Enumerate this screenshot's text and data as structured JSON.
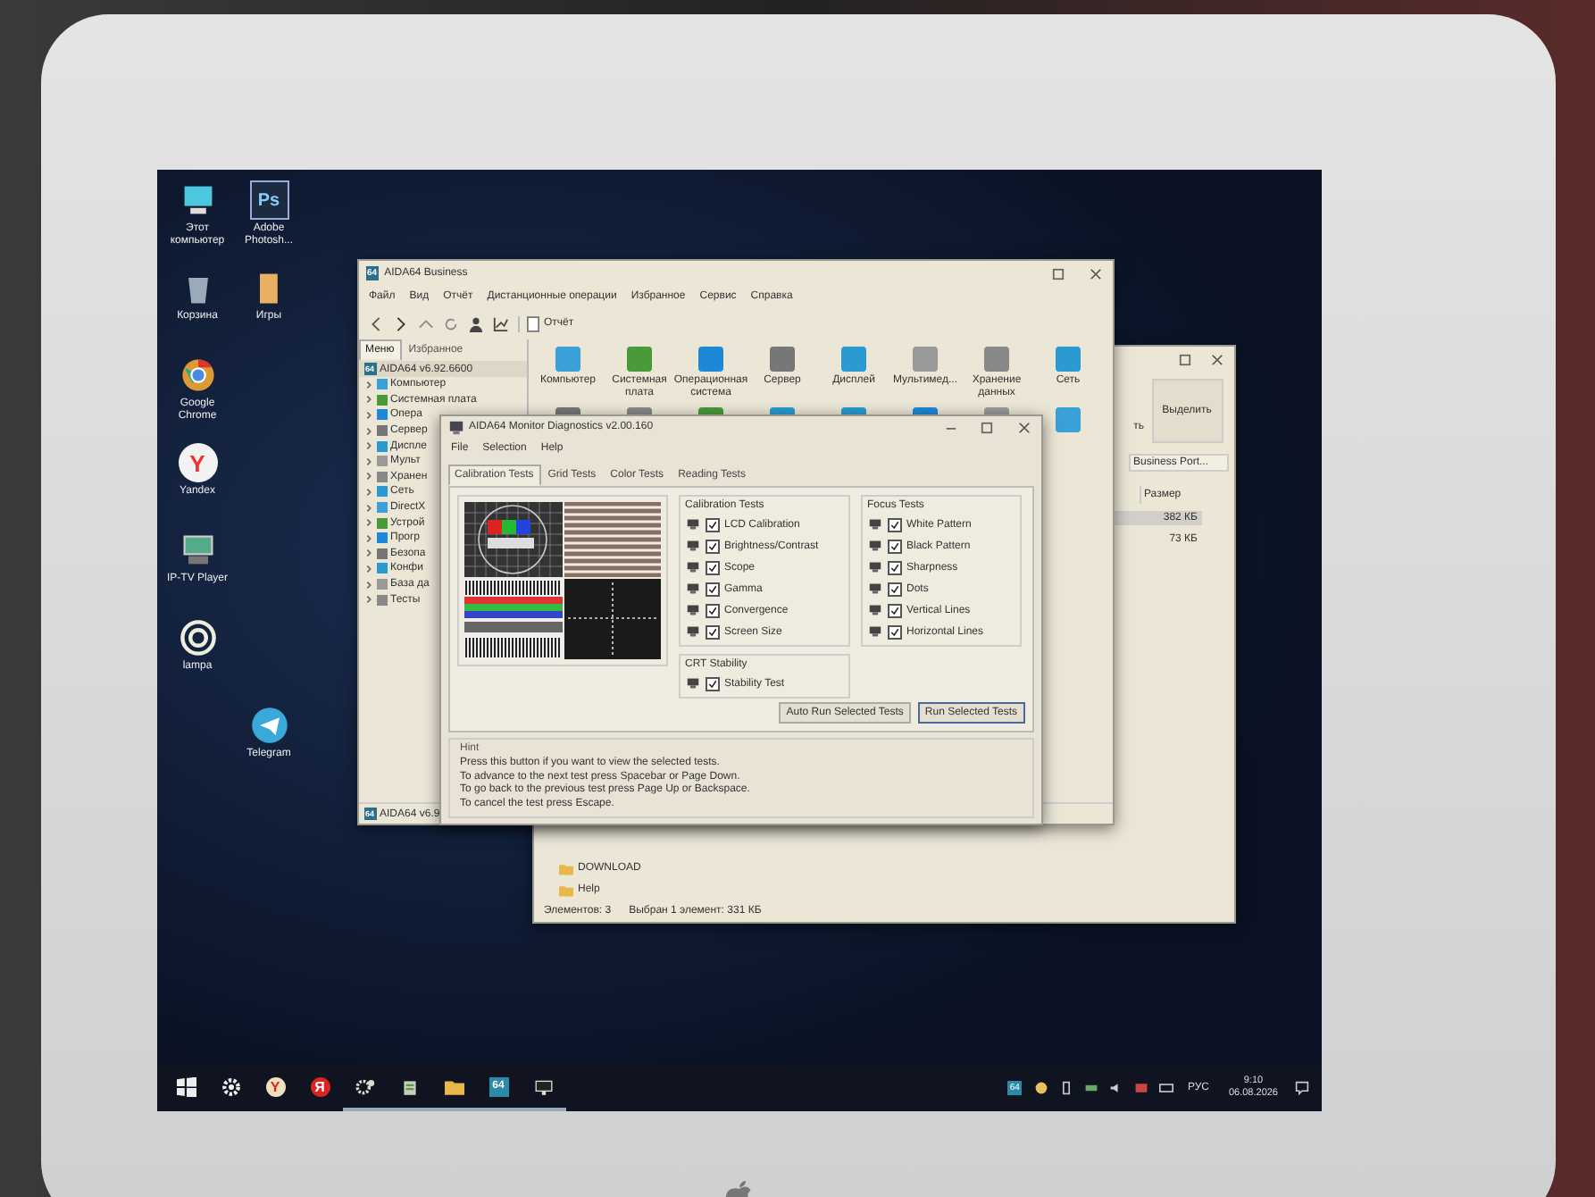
{
  "desktop_icons": [
    {
      "kind": "computer",
      "label": "Этот компьютер"
    },
    {
      "kind": "trash",
      "label": "Корзина"
    },
    {
      "kind": "chrome",
      "label": "Google Chrome"
    },
    {
      "kind": "yandex",
      "label": "Yandex",
      "icon_text": "Y"
    },
    {
      "kind": "tv",
      "label": "IP-TV Player"
    },
    {
      "kind": "lamp",
      "label": "lampa"
    },
    {
      "kind": "photoshop",
      "label": "Adobe Photosh...",
      "icon_text": "Ps"
    },
    {
      "kind": "folder",
      "label": "Игры"
    },
    {
      "kind": "telegram",
      "label": "Telegram"
    }
  ],
  "explorer_window": {
    "ribbon_button": "Выделить",
    "ribbon_fragment": "ть",
    "search": "Business Port...",
    "column": "Размер",
    "sizes": [
      "382 КБ",
      "73 КБ"
    ],
    "folders": [
      "DOWNLOAD",
      "Help"
    ],
    "status": [
      "Элементов: 3",
      "Выбран 1 элемент: 331 КБ"
    ]
  },
  "aida_window": {
    "title_icon_text": "64",
    "title": "AIDA64 Business",
    "menu": [
      "Файл",
      "Вид",
      "Отчёт",
      "Дистанционные операции",
      "Избранное",
      "Сервис",
      "Справка"
    ],
    "toolbar_button": "Отчёт",
    "tabs": [
      {
        "label": "Меню",
        "selected": true
      },
      {
        "label": "Избранное",
        "selected": false
      }
    ],
    "tree": {
      "icon_text": "64",
      "label": "AIDA64 v6.92.6600",
      "children": [
        {
          "label": "Компьютер",
          "expanded": false
        },
        {
          "label": "Системная плата",
          "expanded": false
        },
        {
          "label": "Опера",
          "expanded": false
        },
        {
          "label": "Сервер",
          "expanded": false
        },
        {
          "label": "Диспле",
          "expanded": false
        },
        {
          "label": "Мульт",
          "expanded": false
        },
        {
          "label": "Хранен",
          "expanded": false
        },
        {
          "label": "Сеть",
          "expanded": false
        },
        {
          "label": "DirectX",
          "expanded": false
        },
        {
          "label": "Устрой",
          "expanded": false
        },
        {
          "label": "Прогр",
          "expanded": false
        },
        {
          "label": "Безопа",
          "expanded": false
        },
        {
          "label": "Конфи",
          "expanded": false
        },
        {
          "label": "База да",
          "expanded": false
        },
        {
          "label": "Тесты",
          "expanded": false
        }
      ]
    },
    "categories": [
      "Компьютер",
      "Системная плата",
      "Операционная система",
      "Сервер",
      "Дисплей",
      "Мультимед...",
      "Хранение данных",
      "Сеть"
    ],
    "status_icon_text": "64",
    "status": "AIDA64 v6.9"
  },
  "diagnostics_dialog": {
    "title": "AIDA64 Monitor Diagnostics v2.00.160",
    "menu": [
      "File",
      "Selection",
      "Help"
    ],
    "tabs": [
      {
        "label": "Calibration Tests",
        "selected": true
      },
      {
        "label": "Grid Tests",
        "selected": false
      },
      {
        "label": "Color Tests",
        "selected": false
      },
      {
        "label": "Reading Tests",
        "selected": false
      }
    ],
    "groups": [
      {
        "title": "Calibration Tests",
        "items": [
          {
            "label": "LCD Calibration",
            "checked": true
          },
          {
            "label": "Brightness/Contrast",
            "checked": true
          },
          {
            "label": "Scope",
            "checked": true
          },
          {
            "label": "Gamma",
            "checked": true
          },
          {
            "label": "Convergence",
            "checked": true
          },
          {
            "label": "Screen Size",
            "checked": true
          }
        ]
      },
      {
        "title": "Focus Tests",
        "items": [
          {
            "label": "White Pattern",
            "checked": true
          },
          {
            "label": "Black Pattern",
            "checked": true
          },
          {
            "label": "Sharpness",
            "checked": true
          },
          {
            "label": "Dots",
            "checked": true
          },
          {
            "label": "Vertical Lines",
            "checked": true
          },
          {
            "label": "Horizontal Lines",
            "checked": true
          }
        ]
      },
      {
        "title": "CRT Stability",
        "items": [
          {
            "label": "Stability Test",
            "checked": true
          }
        ]
      }
    ],
    "buttons": [
      "Auto Run Selected Tests",
      "Run Selected Tests"
    ],
    "hint_title": "Hint",
    "hint_lines": [
      "Press this button if you want to view the selected tests.",
      "To advance to the next test press Spacebar or Page Down.",
      "To go back to the previous test press Page Up or Backspace.",
      "To cancel the test press Escape."
    ]
  },
  "taskbar": {
    "apps": [
      {
        "kind": "start",
        "open": false
      },
      {
        "kind": "settings",
        "open": false
      },
      {
        "kind": "browser",
        "open": false,
        "icon_text": "Y"
      },
      {
        "kind": "yandex",
        "open": false,
        "icon_text": "Я"
      },
      {
        "kind": "gear",
        "open": true
      },
      {
        "kind": "installer",
        "open": true
      },
      {
        "kind": "folder",
        "open": true
      },
      {
        "kind": "aida",
        "open": true,
        "icon_text": "64"
      },
      {
        "kind": "monitor",
        "open": true
      }
    ],
    "tray_icon_text": "64",
    "language": "РУС",
    "time": "9:10",
    "date": "06.08.2026"
  }
}
